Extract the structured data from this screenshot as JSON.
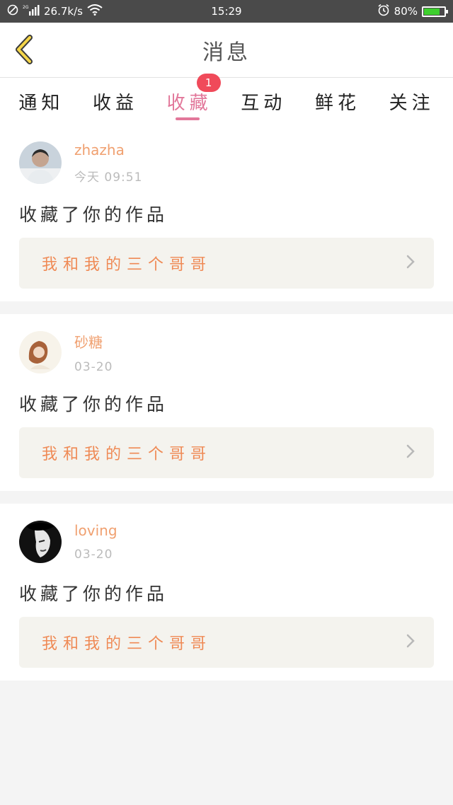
{
  "status_bar": {
    "network": "26.7k/s",
    "time": "15:29",
    "battery": "80%",
    "battery_level": 0.8
  },
  "header": {
    "title": "消息",
    "back_icon": "chevron-left-icon"
  },
  "tabs": [
    {
      "label": "通知"
    },
    {
      "label": "收益"
    },
    {
      "label": "收藏",
      "badge": "1",
      "active": true
    },
    {
      "label": "互动"
    },
    {
      "label": "鲜花"
    },
    {
      "label": "关注"
    }
  ],
  "cards": [
    {
      "username": "zhazha",
      "time": "今天 09:51",
      "action": "收藏了你的作品",
      "work_title": "我和我的三个哥哥"
    },
    {
      "username": "砂糖",
      "time": "03-20",
      "action": "收藏了你的作品",
      "work_title": "我和我的三个哥哥"
    },
    {
      "username": "loving",
      "time": "03-20",
      "action": "收藏了你的作品",
      "work_title": "我和我的三个哥哥"
    }
  ],
  "colors": {
    "accent_pink": "#e2779a",
    "username_orange": "#f0a070",
    "link_orange": "#ef8a55",
    "badge_red": "#f04a5a",
    "back_yellow": "#f5d64a"
  }
}
